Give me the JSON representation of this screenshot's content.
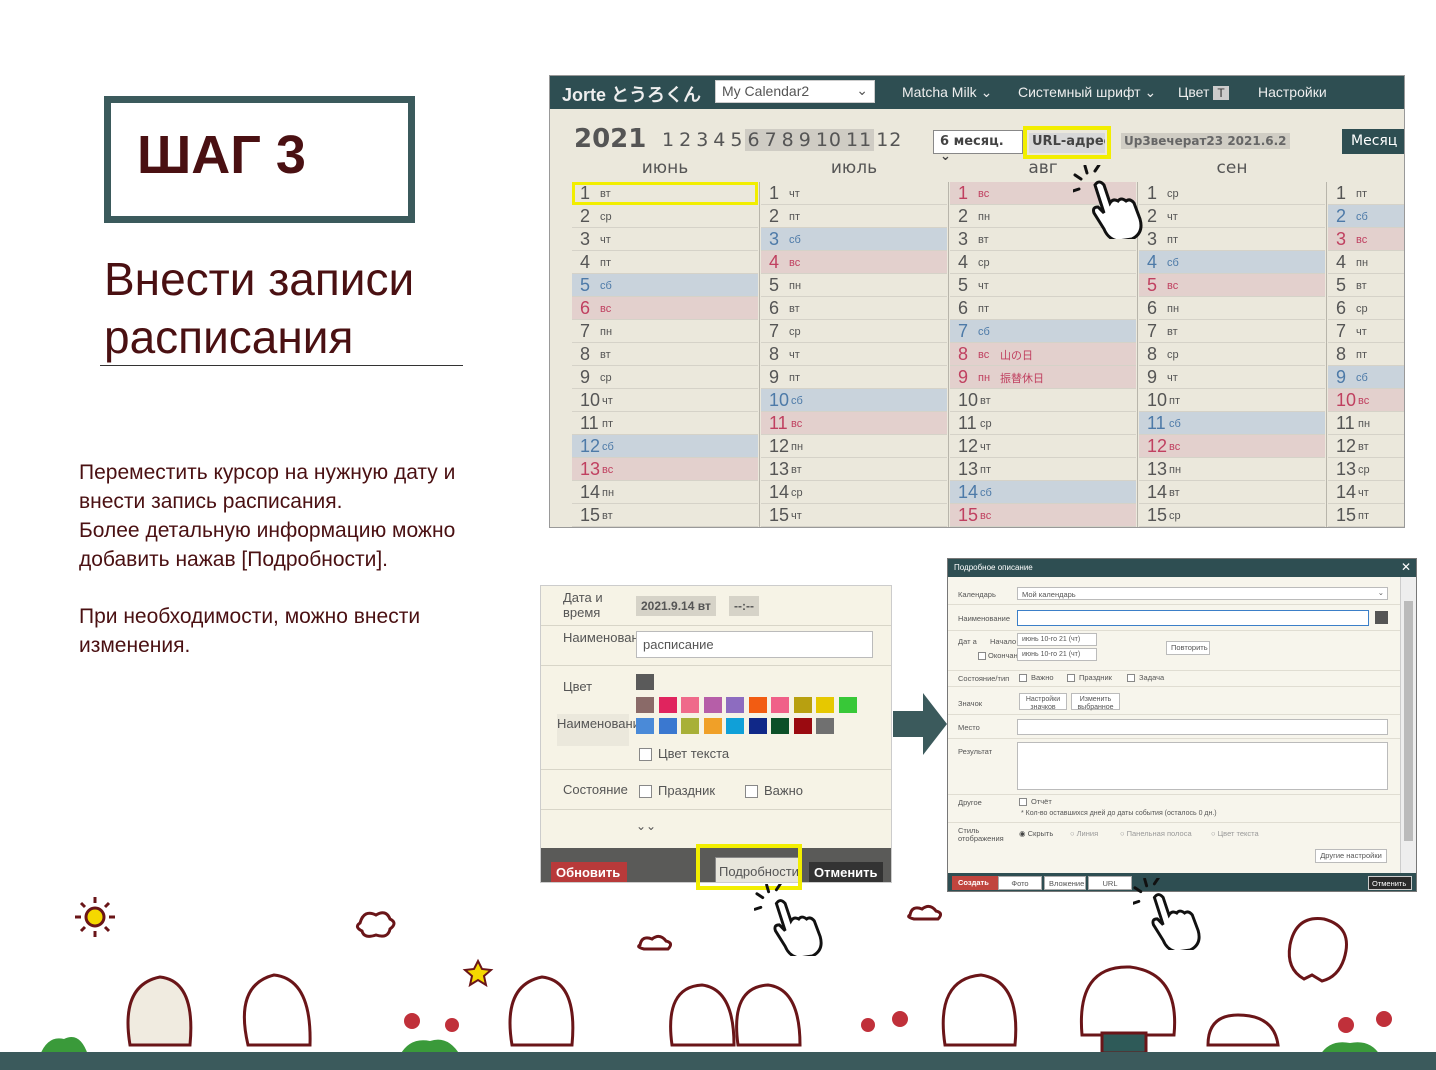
{
  "step": {
    "title": "ШАГ 3"
  },
  "heading": {
    "line1": "Внести записи",
    "line2": "расписания"
  },
  "instructions": {
    "p1": "Переместить курсор на нужную дату и внести запись расписания.",
    "p2": "Более детальную информацию можно добавить нажав [Подробности].",
    "p3": "При необходимости, можно внести изменения."
  },
  "calendar": {
    "logo": "Jorte とうろくん",
    "calendar_select": "My Calendar2",
    "menu": {
      "theme": "Matcha Milk",
      "font": "Системный шрифт",
      "color": "Цвет",
      "color_badge": "T",
      "settings": "Настройки"
    },
    "year": "2021",
    "months": [
      "1",
      "2",
      "3",
      "4",
      "5",
      "6",
      "7",
      "8",
      "9",
      "10",
      "11",
      "12"
    ],
    "range_select": "6 месяц.",
    "url_button": "URL-адрес",
    "published": "Up3вечерат23 2021.6.2",
    "month_button": "Месяц",
    "columns": [
      {
        "name": "июнь",
        "days": [
          [
            "1",
            "вт",
            ""
          ],
          [
            "2",
            "ср",
            ""
          ],
          [
            "3",
            "чт",
            ""
          ],
          [
            "4",
            "пт",
            ""
          ],
          [
            "5",
            "сб",
            "sat"
          ],
          [
            "6",
            "вс",
            "sun"
          ],
          [
            "7",
            "пн",
            ""
          ],
          [
            "8",
            "вт",
            ""
          ],
          [
            "9",
            "ср",
            ""
          ],
          [
            "10",
            "чт",
            ""
          ],
          [
            "11",
            "пт",
            ""
          ],
          [
            "12",
            "сб",
            "sat"
          ],
          [
            "13",
            "вс",
            "sun"
          ],
          [
            "14",
            "пн",
            ""
          ],
          [
            "15",
            "вт",
            ""
          ]
        ]
      },
      {
        "name": "июль",
        "days": [
          [
            "1",
            "чт",
            ""
          ],
          [
            "2",
            "пт",
            ""
          ],
          [
            "3",
            "сб",
            "sat"
          ],
          [
            "4",
            "вс",
            "sun"
          ],
          [
            "5",
            "пн",
            ""
          ],
          [
            "6",
            "вт",
            ""
          ],
          [
            "7",
            "ср",
            ""
          ],
          [
            "8",
            "чт",
            ""
          ],
          [
            "9",
            "пт",
            ""
          ],
          [
            "10",
            "сб",
            "sat"
          ],
          [
            "11",
            "вс",
            "sun"
          ],
          [
            "12",
            "пн",
            ""
          ],
          [
            "13",
            "вт",
            ""
          ],
          [
            "14",
            "ср",
            ""
          ],
          [
            "15",
            "чт",
            ""
          ]
        ]
      },
      {
        "name": "авг",
        "days": [
          [
            "1",
            "вс",
            "sun"
          ],
          [
            "2",
            "пн",
            ""
          ],
          [
            "3",
            "вт",
            ""
          ],
          [
            "4",
            "ср",
            ""
          ],
          [
            "5",
            "чт",
            ""
          ],
          [
            "6",
            "пт",
            ""
          ],
          [
            "7",
            "сб",
            "sat"
          ],
          [
            "8",
            "вс",
            "sun",
            "山の日"
          ],
          [
            "9",
            "пн",
            "sun",
            "振替休日"
          ],
          [
            "10",
            "вт",
            ""
          ],
          [
            "11",
            "ср",
            ""
          ],
          [
            "12",
            "чт",
            ""
          ],
          [
            "13",
            "пт",
            ""
          ],
          [
            "14",
            "сб",
            "sat"
          ],
          [
            "15",
            "вс",
            "sun"
          ]
        ]
      },
      {
        "name": "сен",
        "days": [
          [
            "1",
            "ср",
            ""
          ],
          [
            "2",
            "чт",
            ""
          ],
          [
            "3",
            "пт",
            ""
          ],
          [
            "4",
            "сб",
            "sat"
          ],
          [
            "5",
            "вс",
            "sun"
          ],
          [
            "6",
            "пн",
            ""
          ],
          [
            "7",
            "вт",
            ""
          ],
          [
            "8",
            "ср",
            ""
          ],
          [
            "9",
            "чт",
            ""
          ],
          [
            "10",
            "пт",
            ""
          ],
          [
            "11",
            "сб",
            "sat"
          ],
          [
            "12",
            "вс",
            "sun"
          ],
          [
            "13",
            "пн",
            ""
          ],
          [
            "14",
            "вт",
            ""
          ],
          [
            "15",
            "ср",
            ""
          ]
        ]
      },
      {
        "name": "",
        "days": [
          [
            "1",
            "пт",
            ""
          ],
          [
            "2",
            "сб",
            "sat"
          ],
          [
            "3",
            "вс",
            "sun"
          ],
          [
            "4",
            "пн",
            ""
          ],
          [
            "5",
            "вт",
            ""
          ],
          [
            "6",
            "ср",
            ""
          ],
          [
            "7",
            "чт",
            ""
          ],
          [
            "8",
            "пт",
            ""
          ],
          [
            "9",
            "сб",
            "sat"
          ],
          [
            "10",
            "вс",
            "sun"
          ],
          [
            "11",
            "пн",
            ""
          ],
          [
            "12",
            "вт",
            ""
          ],
          [
            "13",
            "ср",
            ""
          ],
          [
            "14",
            "чт",
            ""
          ],
          [
            "15",
            "пт",
            ""
          ]
        ]
      }
    ]
  },
  "event_dialog": {
    "date_label": "Дата и время",
    "date_value": "2021.9.14 вт",
    "time_value": "--:--",
    "name_label": "Наименование",
    "name_value": "расписание",
    "color_label": "Цвет",
    "name_btn": "Наименование",
    "text_color": "Цвет текста",
    "state_label": "Состояние",
    "holiday": "Праздник",
    "important": "Важно",
    "expand": "⌄⌄",
    "update": "Обновить",
    "details": "Подробности",
    "cancel": "Отменить",
    "swatches": [
      "#5a5a5a",
      "#8a6a68",
      "#e0245e",
      "#ef6a8a",
      "#b65ea8",
      "#8d6cc0",
      "#f25c12",
      "#f06088",
      "#b8a010",
      "#e6c800",
      "#38c838",
      "#4a8ad8",
      "#3a78d0",
      "#a8b038",
      "#f0a028",
      "#10a0d8",
      "#102888",
      "#0c5028",
      "#9a0a10",
      "#707070"
    ]
  },
  "detail_dialog": {
    "title": "Подробное описание",
    "calendar_label": "Календарь",
    "calendar_value": "Мой календарь",
    "name_label": "Наименование",
    "date_label": "Дат а",
    "start_label": "Начало",
    "end_label": "Окончание",
    "start_value": "июнь 10-го 21 (чт)",
    "end_value": "июнь 10-го 21 (чт)",
    "repeat": "Повторить",
    "state_label": "Состояние/тип",
    "important": "Важно",
    "holiday": "Праздник",
    "task": "Задача",
    "icon_label": "Значок",
    "icon_settings": "Настройки значков",
    "icon_change": "Изменить выбранное",
    "place_label": "Место",
    "result_label": "Результат",
    "other_label": "Другое",
    "report": "Отчёт",
    "days_left": "* Кол-во оставшихся дней до даты события (осталось 0 дн.)",
    "style_label": "Стиль отображения",
    "style_hide": "Скрыть",
    "style_line": "Линия",
    "style_bar": "Панельная полоса",
    "style_text": "Цвет текста",
    "other_settings": "Другие настройки",
    "create": "Создать",
    "photo": "Фото",
    "attachment": "Вложение",
    "url": "URL",
    "cancel": "Отменить"
  }
}
